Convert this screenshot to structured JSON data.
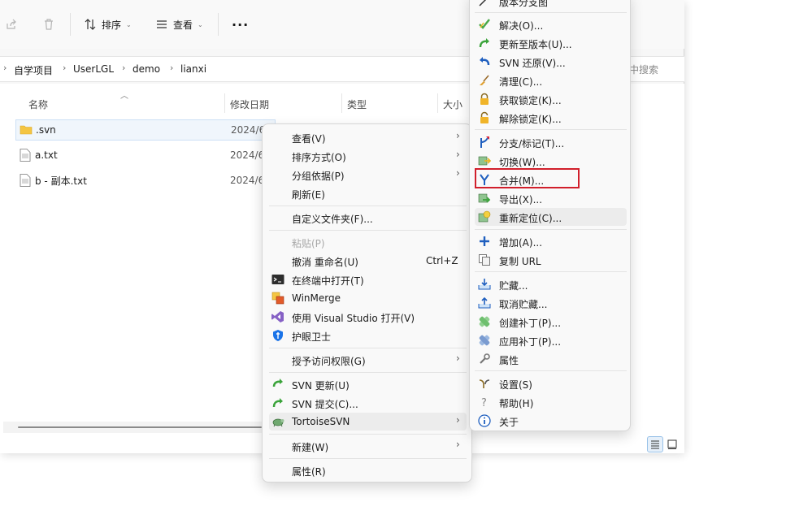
{
  "toolbar": {
    "sort_label": "排序",
    "view_label": "查看",
    "more_label": "···"
  },
  "breadcrumb": [
    "自学项目",
    "UserLGL",
    "demo",
    "lianxi"
  ],
  "search": {
    "placeholder": "中搜索"
  },
  "columns": {
    "name": "名称",
    "modified": "修改日期",
    "type": "类型",
    "size": "大小"
  },
  "files": [
    {
      "name": ".svn",
      "date": "2024/6",
      "kind": "folder"
    },
    {
      "name": "a.txt",
      "date": "2024/6",
      "kind": "text"
    },
    {
      "name": "b - 副本.txt",
      "date": "2024/6",
      "kind": "text"
    }
  ],
  "context_menu": {
    "view": "查看(V)",
    "sort_by": "排序方式(O)",
    "group_by": "分组依据(P)",
    "refresh": "刷新(E)",
    "customize_folder": "自定义文件夹(F)...",
    "paste": "粘贴(P)",
    "undo_rename": "撤消 重命名(U)",
    "undo_shortcut": "Ctrl+Z",
    "open_terminal": "在终端中打开(T)",
    "winmerge": "WinMerge",
    "open_vs": "使用 Visual Studio 打开(V)",
    "guard": "护眼卫士",
    "grant_access": "授予访问权限(G)",
    "svn_update": "SVN 更新(U)",
    "svn_commit": "SVN 提交(C)...",
    "tortoisesvn": "TortoiseSVN",
    "new": "新建(W)",
    "properties": "属性(R)"
  },
  "svn_menu": {
    "revision_graph": "版本分支图",
    "resolve": "解决(O)...",
    "update_to_rev": "更新至版本(U)...",
    "revert": "SVN 还原(V)...",
    "cleanup": "清理(C)...",
    "get_lock": "获取锁定(K)...",
    "release_lock": "解除锁定(K)...",
    "branch_tag": "分支/标记(T)...",
    "switch": "切换(W)...",
    "merge": "合并(M)...",
    "export": "导出(X)...",
    "relocate": "重新定位(C)...",
    "add": "增加(A)...",
    "copy_url": "复制 URL",
    "shelve": "贮藏...",
    "unshelve": "取消贮藏...",
    "create_patch": "创建补丁(P)...",
    "apply_patch": "应用补丁(P)...",
    "properties": "属性",
    "settings": "设置(S)",
    "help": "帮助(H)",
    "about": "关于"
  },
  "colors": {
    "highlight_border": "#d11f2b",
    "svn_green": "#3aa33a",
    "folder_yellow": "#f4c542"
  }
}
